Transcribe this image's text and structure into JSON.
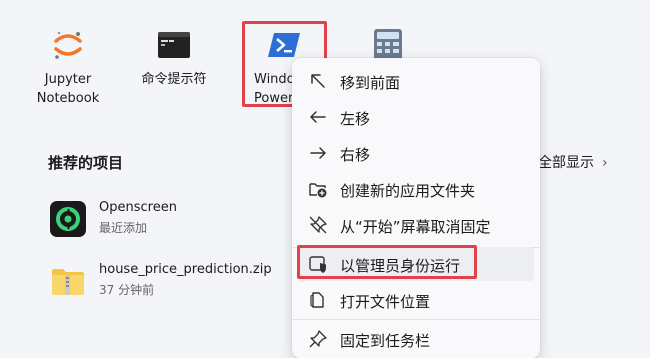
{
  "pinned_apps": [
    {
      "name": "Jupyter Notebook",
      "line1": "Jupyter",
      "line2": "Notebook"
    },
    {
      "name": "命令提示符",
      "line1": "命令提示符",
      "line2": ""
    },
    {
      "name": "Windows PowerShell",
      "line1": "Windo",
      "line2": "PowerS"
    },
    {
      "name": "calculator",
      "line1": "",
      "line2": ""
    }
  ],
  "recommended": {
    "title": "推荐的项目",
    "all_label": "全部显示",
    "items": [
      {
        "name": "Openscreen",
        "subtitle": "最近添加",
        "icon": "openscreen-app-icon"
      },
      {
        "name": "house_price_prediction.zip",
        "subtitle": "37 分钟前",
        "icon": "zip-folder-icon"
      }
    ]
  },
  "context_menu": {
    "items": [
      {
        "label": "移到前面",
        "icon": "arrow-up-left-icon"
      },
      {
        "label": "左移",
        "icon": "arrow-left-icon"
      },
      {
        "label": "右移",
        "icon": "arrow-right-icon"
      },
      {
        "label": "创建新的应用文件夹",
        "icon": "new-folder-icon"
      },
      {
        "label": "从“开始”屏幕取消固定",
        "icon": "unpin-icon"
      },
      {
        "label": "以管理员身份运行",
        "icon": "shield-run-icon"
      },
      {
        "label": "打开文件位置",
        "icon": "open-file-icon"
      },
      {
        "label": "固定到任务栏",
        "icon": "pin-icon"
      }
    ]
  },
  "colors": {
    "highlight": "#e0424a",
    "powershell": "#2b6fd6",
    "openscreen": "#3bd37a",
    "zip": "#f4c542"
  }
}
